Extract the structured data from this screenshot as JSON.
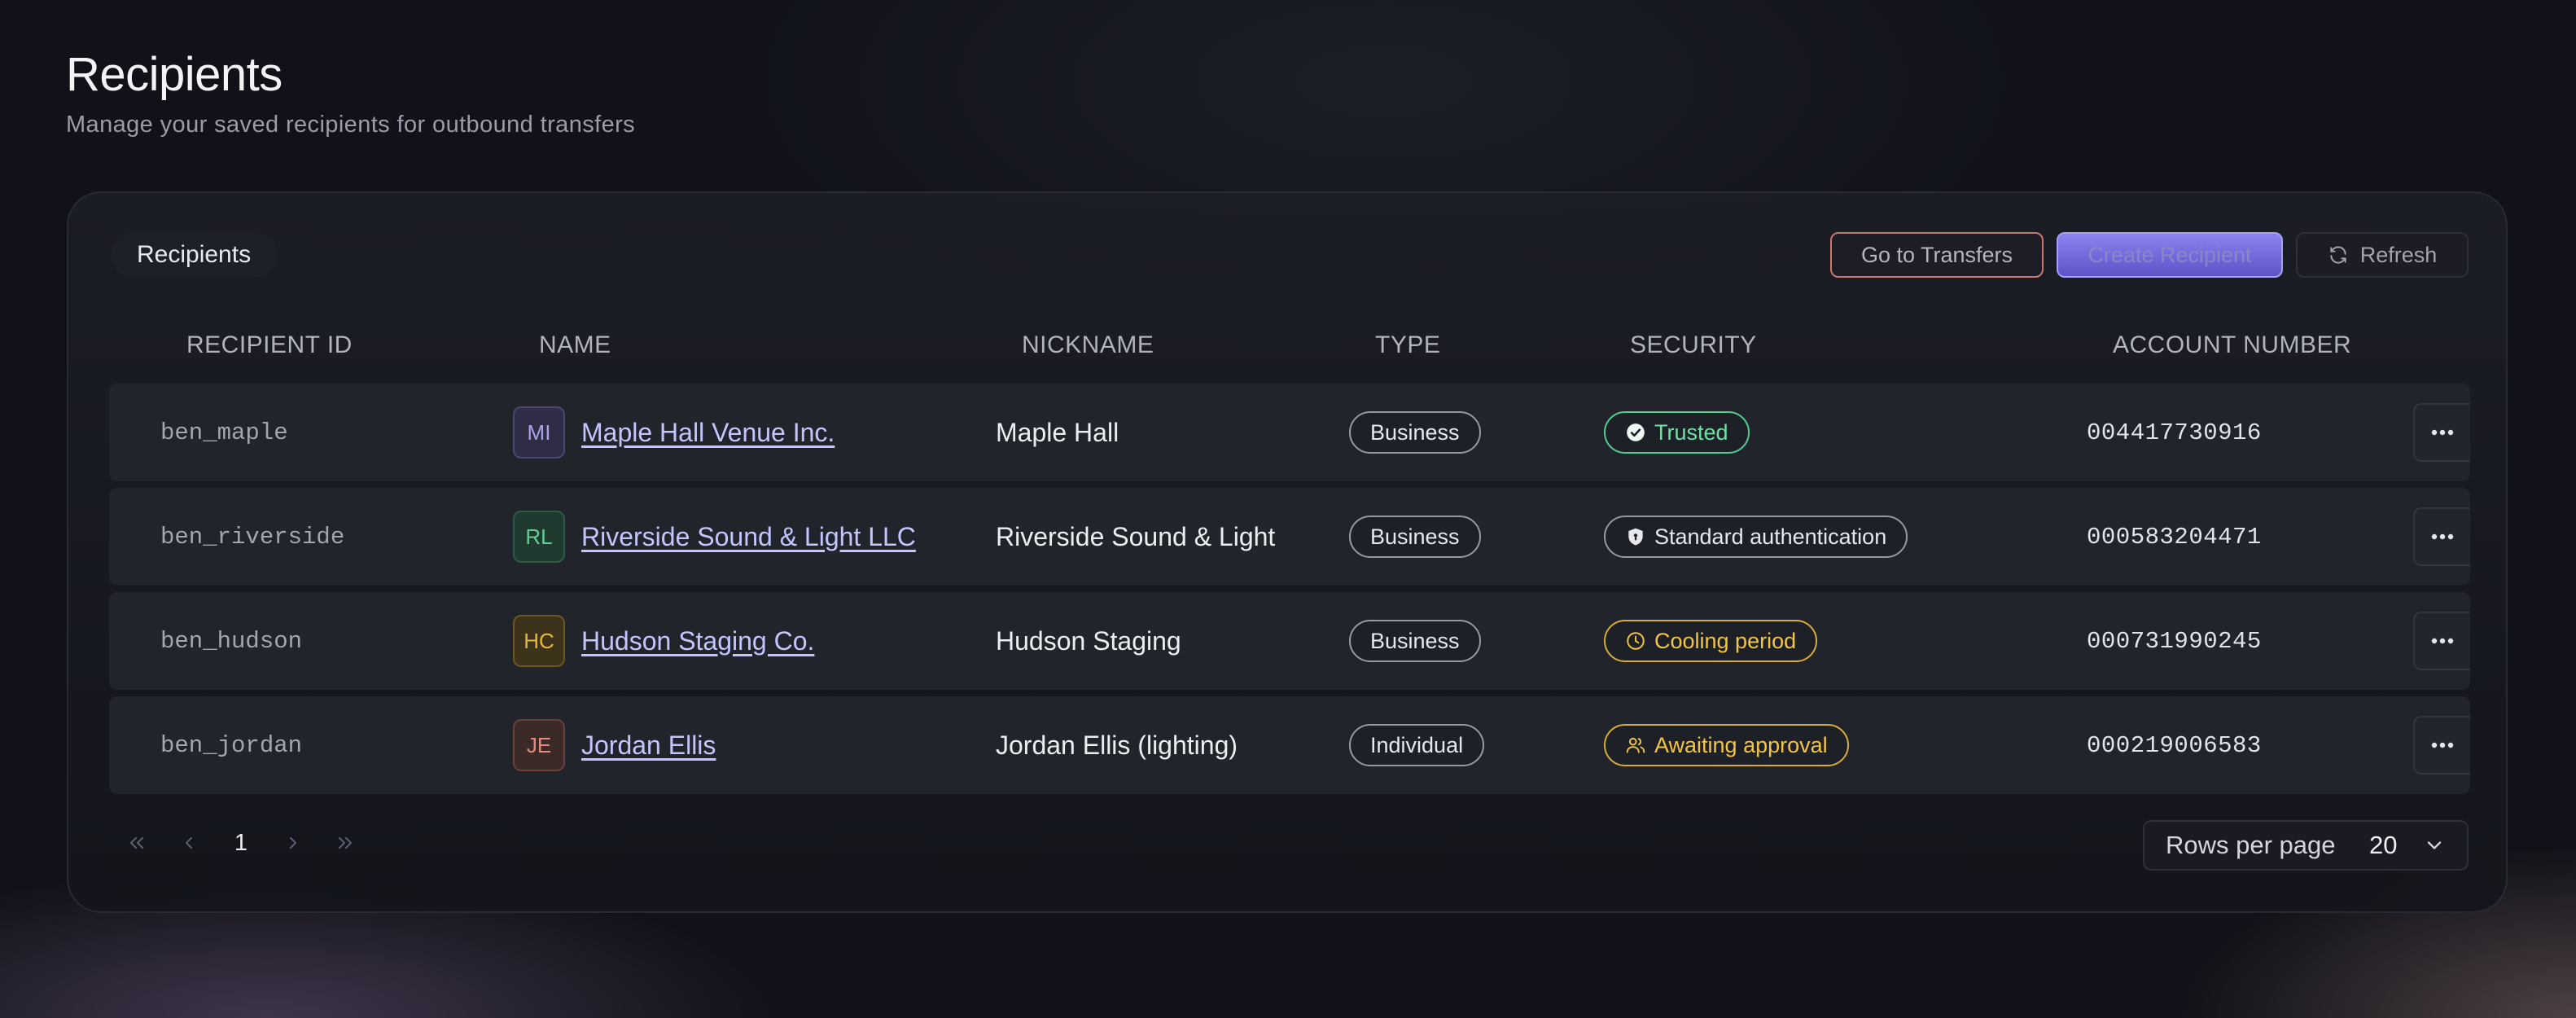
{
  "page": {
    "title": "Recipients",
    "subtitle": "Manage your saved recipients for outbound transfers"
  },
  "card": {
    "chip_label": "Recipients",
    "actions": {
      "go_to_transfers": "Go to Transfers",
      "create_recipient": "Create Recipient",
      "refresh": "Refresh"
    }
  },
  "table": {
    "columns": [
      "RECIPIENT ID",
      "NAME",
      "NICKNAME",
      "TYPE",
      "SECURITY",
      "ACCOUNT NUMBER"
    ],
    "rows": [
      {
        "id": "ben_maple",
        "initials": "MI",
        "name": "Maple Hall Venue Inc.",
        "nickname": "Maple Hall",
        "type": "Business",
        "security": "Trusted",
        "security_icon": "check-circle-icon",
        "account": "004417730916",
        "avatar_color": "#a7a4e8"
      },
      {
        "id": "ben_riverside",
        "initials": "RL",
        "name": "Riverside Sound & Light LLC",
        "nickname": "Riverside Sound & Light",
        "type": "Business",
        "security": "Standard authentication",
        "security_icon": "shield-icon",
        "account": "000583204471",
        "avatar_color": "#5fd08f"
      },
      {
        "id": "ben_hudson",
        "initials": "HC",
        "name": "Hudson Staging Co.",
        "nickname": "Hudson Staging",
        "type": "Business",
        "security": "Cooling period",
        "security_icon": "clock-icon",
        "account": "000731990245",
        "avatar_color": "#e9b73a"
      },
      {
        "id": "ben_jordan",
        "initials": "JE",
        "name": "Jordan Ellis",
        "nickname": "Jordan Ellis (lighting)",
        "type": "Individual",
        "security": "Awaiting approval",
        "security_icon": "users-icon",
        "account": "000219006583",
        "avatar_color": "#e58b7c"
      }
    ]
  },
  "pagination": {
    "current_page": "1",
    "rows_per_page_label": "Rows per page",
    "rows_per_page_value": "20"
  },
  "colors": {
    "accent": "#7a73e8",
    "trusted": "#6ee2a1",
    "warning": "#f3c545",
    "link": "#c3c5ff"
  }
}
